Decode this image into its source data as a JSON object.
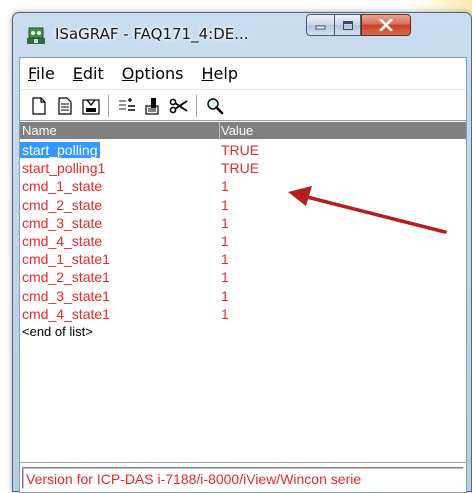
{
  "window": {
    "title": "ISaGRAF - FAQ171_4:DE..."
  },
  "menu": [
    {
      "key": "F",
      "rest": "ile"
    },
    {
      "key": "E",
      "rest": "dit"
    },
    {
      "key": "O",
      "rest": "ptions"
    },
    {
      "key": "H",
      "rest": "elp"
    }
  ],
  "toolbar": {
    "icons": [
      "new-document-icon",
      "open-document-icon",
      "save-icon",
      "insert-variable-icon",
      "edit-variable-icon",
      "cut-icon",
      "search-icon"
    ]
  },
  "list": {
    "headers": {
      "name": "Name",
      "value": "Value"
    },
    "rows": [
      {
        "name": "start_polling",
        "value": "TRUE",
        "selected": true
      },
      {
        "name": "start_polling1",
        "value": "TRUE"
      },
      {
        "name": "cmd_1_state",
        "value": "1"
      },
      {
        "name": "cmd_2_state",
        "value": "1"
      },
      {
        "name": "cmd_3_state",
        "value": "1"
      },
      {
        "name": "cmd_4_state",
        "value": "1"
      },
      {
        "name": "cmd_1_state1",
        "value": "1"
      },
      {
        "name": "cmd_2_state1",
        "value": "1"
      },
      {
        "name": "cmd_3_state1",
        "value": "1"
      },
      {
        "name": "cmd_4_state1",
        "value": "1"
      }
    ],
    "end_marker": "<end of list>"
  },
  "status": {
    "text": "Version for ICP-DAS i-7188/i-8000/iView/Wincon serie"
  },
  "colors": {
    "value_text": "#e8282a",
    "selection": "#3399ff",
    "header_bg": "#808080",
    "annotation_arrow": "#b41e1e"
  }
}
